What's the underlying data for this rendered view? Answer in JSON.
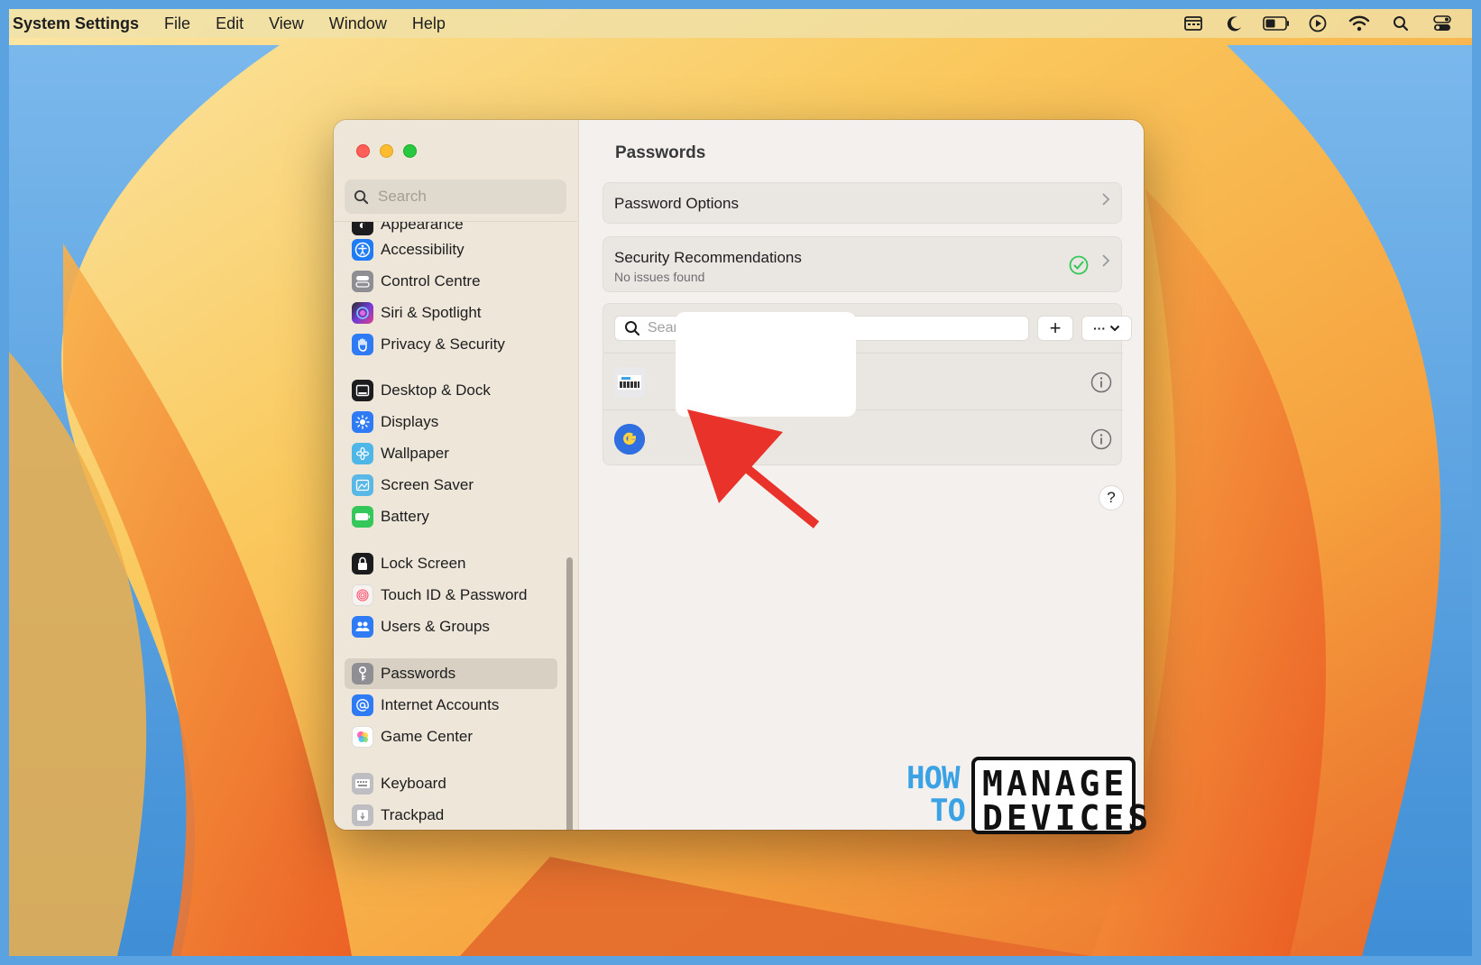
{
  "menubar": {
    "app_name": "System Settings",
    "menus": [
      "File",
      "Edit",
      "View",
      "Window",
      "Help"
    ],
    "status_icons": [
      "calendar-icon",
      "moon-icon",
      "battery-icon",
      "play-icon",
      "wifi-icon",
      "search-icon",
      "control-center-icon"
    ]
  },
  "sidebar": {
    "search_placeholder": "Search",
    "partial_item": "Appearance",
    "items": [
      {
        "label": "Accessibility",
        "icon": "accessibility-icon",
        "color": "#1f7cf5"
      },
      {
        "label": "Control Centre",
        "icon": "control-centre-icon",
        "color": "#8e8e93"
      },
      {
        "label": "Siri & Spotlight",
        "icon": "siri-icon",
        "color": "#6f3bd6"
      },
      {
        "label": "Privacy & Security",
        "icon": "hand-icon",
        "color": "#2f7bf5"
      },
      {
        "label": "Desktop & Dock",
        "icon": "dock-icon",
        "color": "#1c1c1e"
      },
      {
        "label": "Displays",
        "icon": "sun-icon",
        "color": "#2f7bf5"
      },
      {
        "label": "Wallpaper",
        "icon": "flower-icon",
        "color": "#4fb6e8"
      },
      {
        "label": "Screen Saver",
        "icon": "screen-saver-icon",
        "color": "#5ab8e6"
      },
      {
        "label": "Battery",
        "icon": "battery-icon",
        "color": "#34c759"
      },
      {
        "label": "Lock Screen",
        "icon": "lock-icon",
        "color": "#1c1c1e"
      },
      {
        "label": "Touch ID & Password",
        "icon": "fingerprint-icon",
        "color": "#f2f2f2"
      },
      {
        "label": "Users & Groups",
        "icon": "users-icon",
        "color": "#2f7bf5"
      },
      {
        "label": "Passwords",
        "icon": "key-icon",
        "color": "#8e8e93"
      },
      {
        "label": "Internet Accounts",
        "icon": "at-icon",
        "color": "#2f7bf5"
      },
      {
        "label": "Game Center",
        "icon": "game-center-icon",
        "color": "#ffffff"
      },
      {
        "label": "Keyboard",
        "icon": "keyboard-icon",
        "color": "#a0a0a5"
      },
      {
        "label": "Trackpad",
        "icon": "trackpad-icon",
        "color": "#a0a0a5"
      }
    ],
    "selected": "Passwords"
  },
  "content": {
    "title": "Passwords",
    "password_options": "Password Options",
    "security": {
      "title": "Security Recommendations",
      "subtitle": "No issues found"
    },
    "list_search_placeholder": "Search",
    "add_button": "+",
    "more_button": "···",
    "help_button": "?"
  },
  "logo": {
    "how": "HOW",
    "to": "TO",
    "manage": "MANAGE",
    "devices": "DEVICES"
  },
  "colors": {
    "accent_blue": "#2f7bf5",
    "check_green": "#34c759",
    "arrow_red": "#e8322a"
  }
}
